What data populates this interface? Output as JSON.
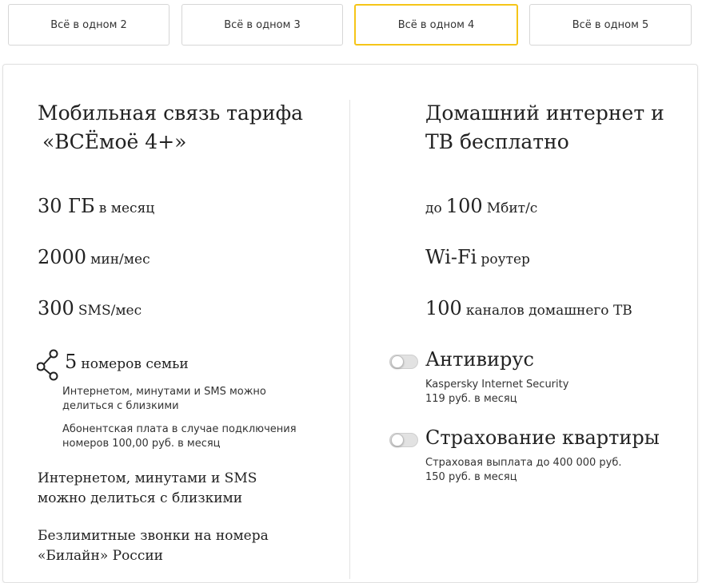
{
  "tabs": [
    {
      "label": "Всё в одном 2"
    },
    {
      "label": "Всё в одном 3"
    },
    {
      "label": "Всё в одном 4"
    },
    {
      "label": "Всё в одном 5"
    }
  ],
  "active_tab": "Всё в одном 4",
  "accent_color": "#f5c518",
  "left": {
    "title_line1": "Мобильная связь тарифа",
    "title_line2": "«ВСЁмоё 4+»",
    "internet": {
      "value": "30 ГБ",
      "unit": "в месяц"
    },
    "minutes": {
      "value": "2000",
      "unit": "мин/мес"
    },
    "sms": {
      "value": "300",
      "unit": "SMS/мес"
    },
    "family": {
      "value": "5",
      "unit": "номеров семьи",
      "icon": "share-icon",
      "note1_line1": "Интернетом, минутами и SMS можно",
      "note1_line2": "делиться с близкими",
      "note2_line1": "Абонентская плата в случае подключения",
      "note2_line2": "номеров 100,00 руб. в месяц"
    },
    "sharing_line1": "Интернетом, минутами и SMS",
    "sharing_line2": "можно делиться с близкими",
    "unlimited_line1": "Безлимитные звонки на номера",
    "unlimited_line2": "«Билайн» России"
  },
  "right": {
    "title_line1": "Домашний интернет и",
    "title_line2": "ТВ бесплатно",
    "speed": {
      "prefix": "до",
      "value": "100",
      "unit": "Мбит/с"
    },
    "wifi": {
      "value": "Wi-Fi",
      "unit": "роутер"
    },
    "tv": {
      "value": "100",
      "unit": "каналов домашнего ТВ"
    },
    "antivirus": {
      "label": "Антивирус",
      "line1": "Kaspersky Internet Security",
      "line2": "119 руб. в месяц",
      "enabled": false
    },
    "insurance": {
      "label": "Страхование квартиры",
      "line1": "Страховая выплата до 400 000 руб.",
      "line2": "150 руб. в месяц",
      "enabled": false
    }
  }
}
